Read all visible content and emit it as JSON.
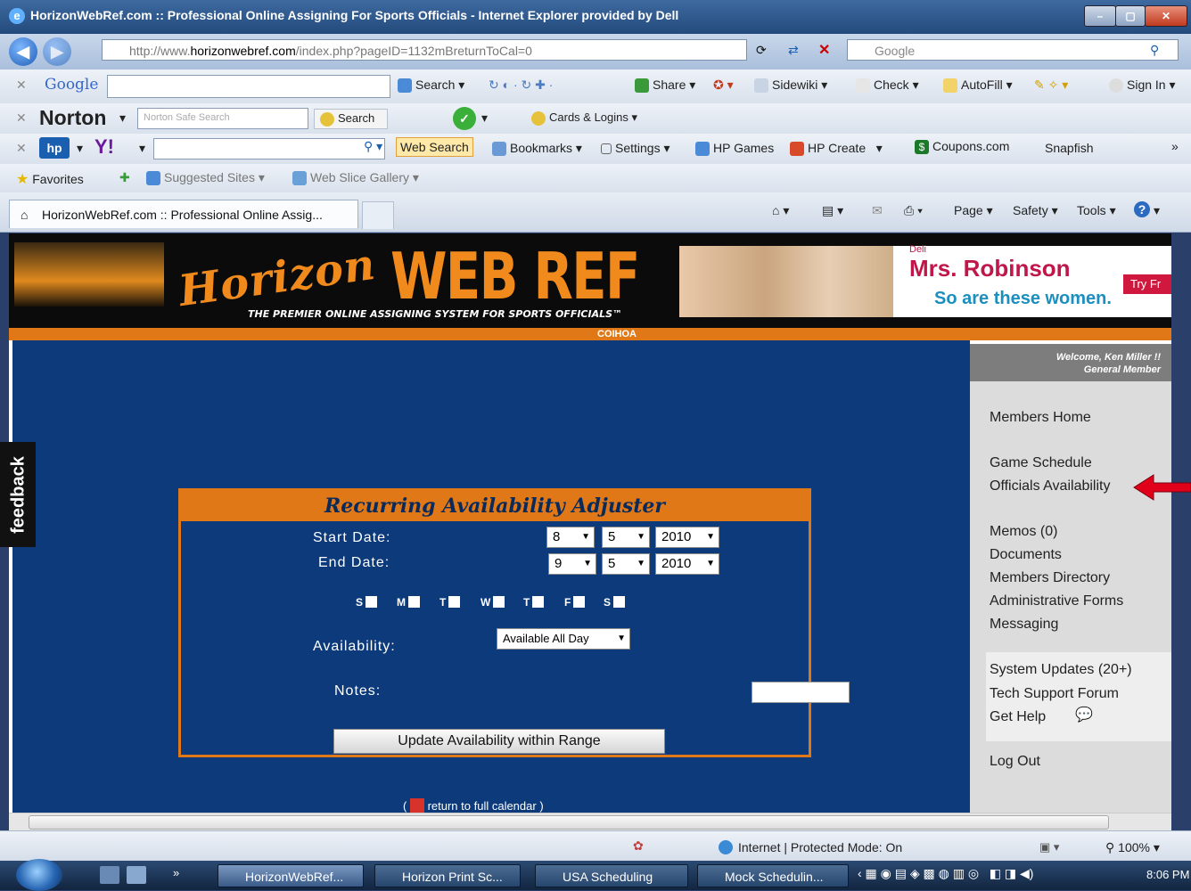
{
  "window": {
    "title": "HorizonWebRef.com :: Professional Online Assigning For Sports Officials - Internet Explorer provided by Dell"
  },
  "address": {
    "url_prefix": "http://www.",
    "url_domain": "horizonwebref.com",
    "url_rest": "/index.php?pageID=1132mBreturnToCal=0",
    "search_placeholder": "Google"
  },
  "google_toolbar": {
    "logo": "Google",
    "search": "Search",
    "share": "Share",
    "sidewiki": "Sidewiki",
    "check": "Check",
    "autofill": "AutoFill",
    "sign_in": "Sign In"
  },
  "norton_toolbar": {
    "logo": "Norton",
    "search_placeholder": "Norton Safe Search",
    "search": "Search",
    "cards": "Cards & Logins"
  },
  "yahoo_toolbar": {
    "web_search": "Web Search",
    "bookmarks": "Bookmarks",
    "settings": "Settings",
    "hp_games": "HP Games",
    "hp_create": "HP Create",
    "coupons": "Coupons.com",
    "snapfish": "Snapfish"
  },
  "favorites_bar": {
    "favorites": "Favorites",
    "suggested": "Suggested Sites",
    "webslice": "Web Slice Gallery"
  },
  "tab": {
    "title": "HorizonWebRef.com :: Professional Online Assig..."
  },
  "commandbar": {
    "page": "Page",
    "safety": "Safety",
    "tools": "Tools"
  },
  "site": {
    "logo_script": "Horizon",
    "logo_main": "WEB REF",
    "tagline": "THE PREMIER ONLINE ASSIGNING SYSTEM FOR SPORTS OFFICIALS™",
    "org": "COIHOA"
  },
  "ad": {
    "brand": "Deli",
    "headline": "Mrs. Robinson",
    "sub": "So are these women.",
    "cta": "Try Fr"
  },
  "form": {
    "title": "Recurring Availability Adjuster",
    "start_label": "Start Date:",
    "end_label": "End Date:",
    "start": {
      "month": "8",
      "day": "5",
      "year": "2010"
    },
    "end": {
      "month": "9",
      "day": "5",
      "year": "2010"
    },
    "days": [
      "S",
      "M",
      "T",
      "W",
      "T",
      "F",
      "S"
    ],
    "availability_label": "Availability:",
    "availability_value": "Available All Day",
    "notes_label": "Notes:",
    "notes_value": "",
    "submit": "Update Availability within Range",
    "return_link": "return to full calendar"
  },
  "feedback": "feedback",
  "sidebar": {
    "welcome": "Welcome, Ken Miller !!",
    "member_type": "General Member",
    "links": [
      "Members Home",
      "Game Schedule",
      "Officials Availability",
      "Memos (0)",
      "Documents",
      "Members Directory",
      "Administrative Forms",
      "Messaging",
      "System Updates (20+)",
      "Tech Support Forum",
      "Get Help",
      "Log Out"
    ]
  },
  "statusbar": {
    "zone": "Internet | Protected Mode: On",
    "zoom": "100%"
  },
  "taskbar": {
    "items": [
      "HorizonWebRef...",
      "Horizon Print Sc...",
      "USA Scheduling",
      "Mock Schedulin..."
    ],
    "clock": "8:06 PM"
  },
  "colors": {
    "accent_orange": "#e07818",
    "page_navy": "#0c3a7a",
    "arrow_red": "#e0001a"
  }
}
